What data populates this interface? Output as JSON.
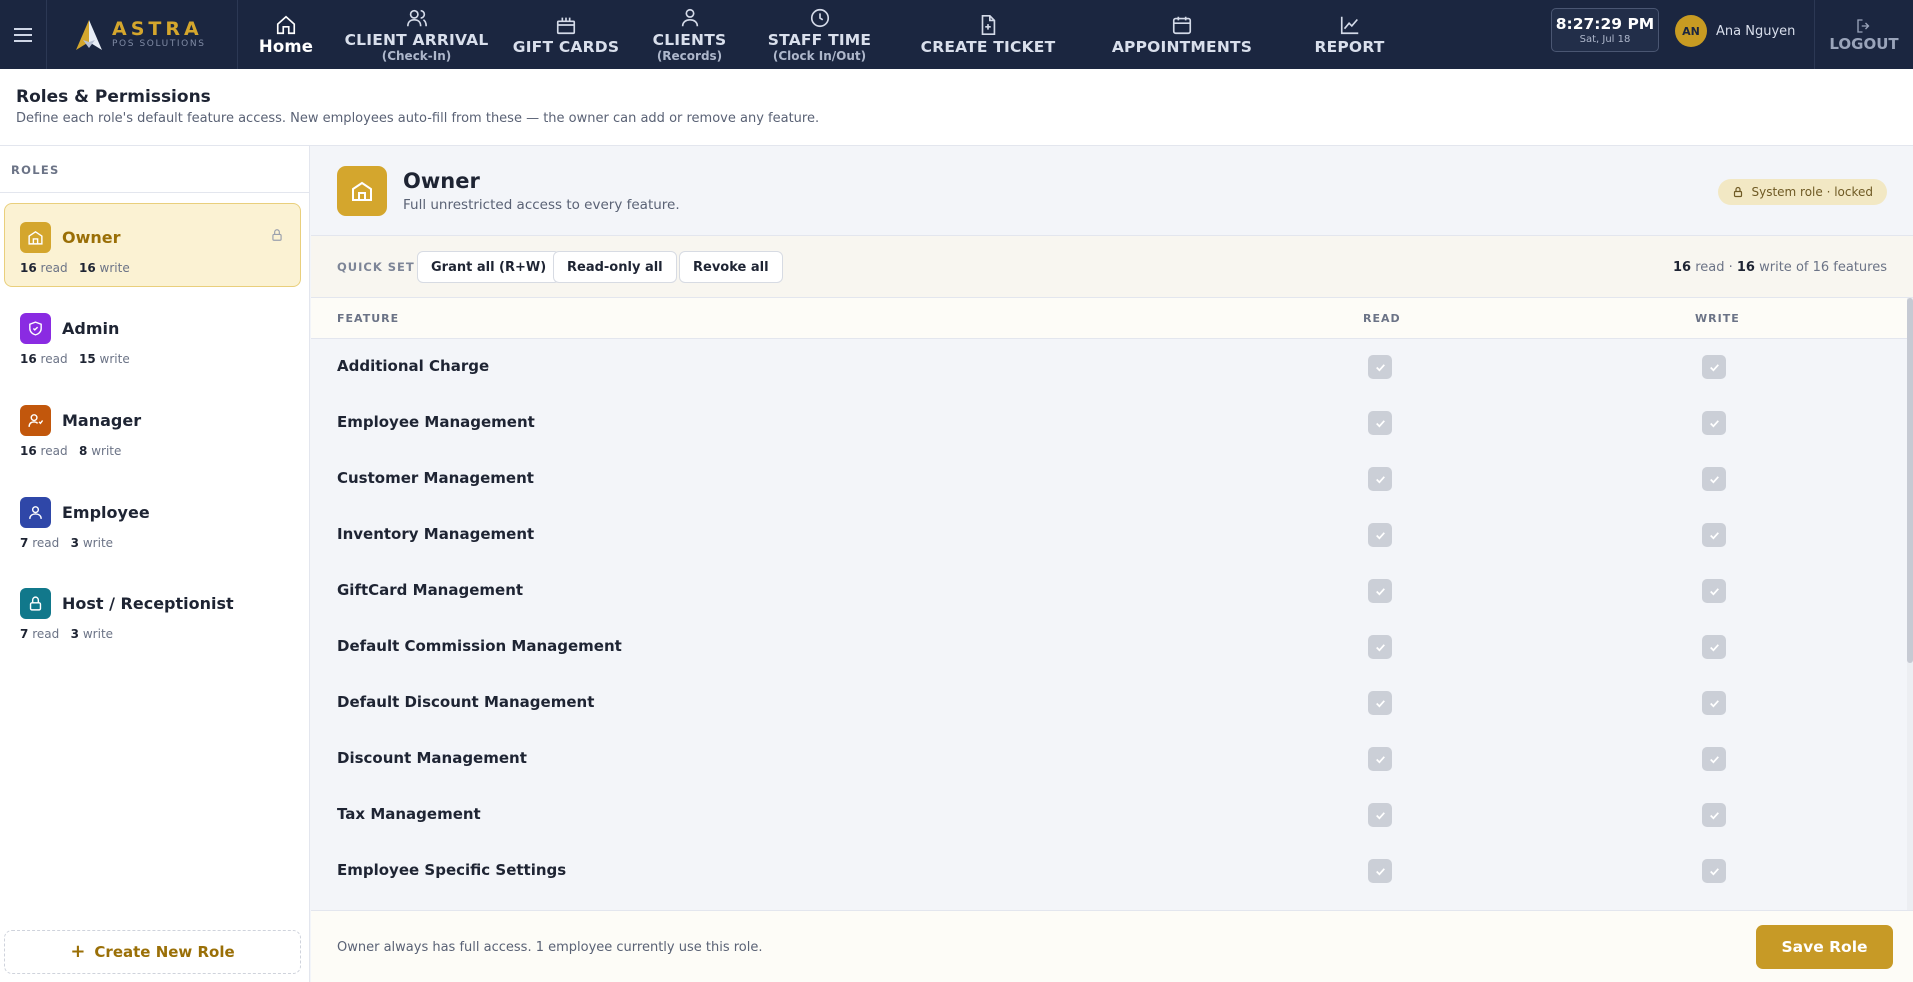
{
  "brand": {
    "name": "ASTRA",
    "sub": "POS SOLUTIONS"
  },
  "nav": {
    "items": [
      {
        "label": "Home",
        "sub": "",
        "icon": "home-icon"
      },
      {
        "label": "CLIENT ARRIVAL",
        "sub": "(Check-In)",
        "icon": "users-icon"
      },
      {
        "label": "GIFT CARDS",
        "sub": "",
        "icon": "gift-icon"
      },
      {
        "label": "CLIENTS",
        "sub": "(Records)",
        "icon": "user-icon"
      },
      {
        "label": "STAFF TIME",
        "sub": "(Clock In/Out)",
        "icon": "clock-icon"
      },
      {
        "label": "CREATE TICKET",
        "sub": "",
        "icon": "file-plus-icon"
      },
      {
        "label": "APPOINTMENTS",
        "sub": "",
        "icon": "calendar-icon"
      },
      {
        "label": "REPORT",
        "sub": "",
        "icon": "chart-line-icon"
      }
    ],
    "clock_time": "8:27:29 PM",
    "clock_date": "Sat, Jul 18",
    "user_initials": "AN",
    "user_name": "Ana Nguyen",
    "logout_label": "LOGOUT"
  },
  "page": {
    "title": "Roles & Permissions",
    "description": "Define each role's default feature access. New employees auto-fill from these — the owner can add or remove any feature."
  },
  "sidebar": {
    "heading": "ROLES",
    "roles": [
      {
        "name": "Owner",
        "read": "16",
        "write": "16",
        "color": "#d4a62d",
        "icon": "building-icon",
        "locked": true,
        "active": true
      },
      {
        "name": "Admin",
        "read": "16",
        "write": "15",
        "color": "#8a2be2",
        "icon": "shield-icon",
        "locked": false,
        "active": false
      },
      {
        "name": "Manager",
        "read": "16",
        "write": "8",
        "color": "#c2570c",
        "icon": "user-manager-icon",
        "locked": false,
        "active": false
      },
      {
        "name": "Employee",
        "read": "7",
        "write": "3",
        "color": "#2f47a8",
        "icon": "user-icon",
        "locked": false,
        "active": false
      },
      {
        "name": "Host / Receptionist",
        "read": "7",
        "write": "3",
        "color": "#11788b",
        "icon": "lock-icon",
        "locked": false,
        "active": false
      }
    ],
    "read_word": "read",
    "write_word": "write",
    "create_label": "Create New Role"
  },
  "role": {
    "title": "Owner",
    "description": "Full unrestricted access to every feature.",
    "badge": "System role · locked"
  },
  "quickset": {
    "label": "QUICK SET",
    "buttons": [
      "Grant all (R+W)",
      "Read-only all",
      "Revoke all"
    ],
    "summary_read": "16",
    "summary_read_word": "read ·",
    "summary_write": "16",
    "summary_rest": "write of 16 features"
  },
  "table": {
    "col_feature": "FEATURE",
    "col_read": "READ",
    "col_write": "WRITE",
    "features": [
      {
        "name": "Additional Charge",
        "read": true,
        "write": true
      },
      {
        "name": "Employee Management",
        "read": true,
        "write": true
      },
      {
        "name": "Customer Management",
        "read": true,
        "write": true
      },
      {
        "name": "Inventory Management",
        "read": true,
        "write": true
      },
      {
        "name": "GiftCard Management",
        "read": true,
        "write": true
      },
      {
        "name": "Default Commission Management",
        "read": true,
        "write": true
      },
      {
        "name": "Default Discount Management",
        "read": true,
        "write": true
      },
      {
        "name": "Discount Management",
        "read": true,
        "write": true
      },
      {
        "name": "Tax Management",
        "read": true,
        "write": true
      },
      {
        "name": "Employee Specific Settings",
        "read": true,
        "write": true
      }
    ]
  },
  "footer": {
    "note": "Owner always has full access. 1 employee currently use this role.",
    "save_label": "Save Role"
  }
}
